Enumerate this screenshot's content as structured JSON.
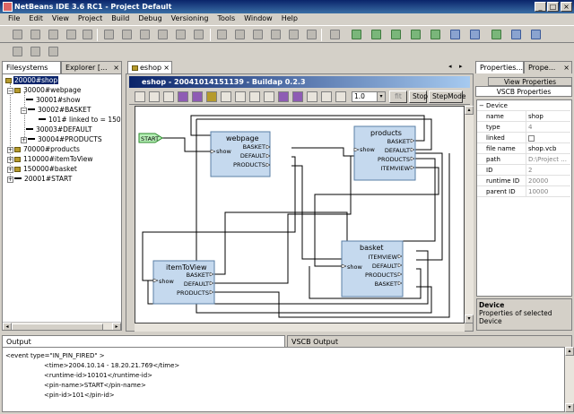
{
  "window": {
    "title": "NetBeans IDE 3.6 RC1 - Project Default",
    "controls": [
      "_",
      "□",
      "×"
    ]
  },
  "menu": [
    "File",
    "Edit",
    "View",
    "Project",
    "Build",
    "Debug",
    "Versioning",
    "Tools",
    "Window",
    "Help"
  ],
  "left_panel": {
    "tabs": [
      {
        "label": "Filesystems"
      },
      {
        "label": "Explorer [..."
      }
    ],
    "tree": [
      {
        "label": "20000#shop",
        "selected": true
      },
      {
        "label": "30000#webpage"
      },
      {
        "label": "30001#show"
      },
      {
        "label": "30002#BASKET"
      },
      {
        "label": "101# linked to = 15000"
      },
      {
        "label": "30003#DEFAULT"
      },
      {
        "label": "30004#PRODUCTS"
      },
      {
        "label": "70000#products"
      },
      {
        "label": "110000#itemToView"
      },
      {
        "label": "150000#basket"
      },
      {
        "label": "20001#START"
      }
    ]
  },
  "center_panel": {
    "tab_label": "eshop",
    "inner_title": "eshop - 20041014151139 - Buildap 0.2.3",
    "zoom_value": "1.0",
    "fit_label": "fit",
    "stop_label": "Stop",
    "stepmode_label": "StepMode",
    "diagram": {
      "start_label": "START",
      "nodes": [
        {
          "title": "webpage",
          "input": "show",
          "outputs": [
            "BASKET",
            "DEFAULT",
            "PRODUCTS"
          ]
        },
        {
          "title": "products",
          "input": "show",
          "outputs": [
            "BASKET",
            "DEFAULT",
            "PRODUCTS",
            "ITEMVIEW"
          ]
        },
        {
          "title": "itemToView",
          "input": "show",
          "outputs": [
            "BASKET",
            "DEFAULT",
            "PRODUCTS"
          ]
        },
        {
          "title": "basket",
          "input": "show",
          "outputs": [
            "ITEMVIEW",
            "DEFAULT",
            "PRODUCTS",
            "BASKET"
          ]
        }
      ]
    }
  },
  "right_panel": {
    "tabs": [
      {
        "label": "Properties..."
      },
      {
        "label": "Prope..."
      }
    ],
    "sub_tabs": [
      "View Properties",
      "VSCB Properties"
    ],
    "section": "Device",
    "properties": [
      {
        "key": "name",
        "value": "shop",
        "dim": false
      },
      {
        "key": "type",
        "value": "4",
        "dim": true
      },
      {
        "key": "linked",
        "value": "",
        "dim": true
      },
      {
        "key": "file name",
        "value": "shop.vcb",
        "dim": false
      },
      {
        "key": "path",
        "value": "D:\\Project ...",
        "dim": true
      },
      {
        "key": "ID",
        "value": "2",
        "dim": true
      },
      {
        "key": "runtime ID",
        "value": "20000",
        "dim": true
      },
      {
        "key": "parent ID",
        "value": "10000",
        "dim": true
      }
    ],
    "desc_title": "Device",
    "desc_text": "Properties of selected Device"
  },
  "bottom_panel": {
    "tabs": [
      {
        "label": "Output"
      },
      {
        "label": "VSCB Output"
      }
    ],
    "lines": [
      "<event type=\"IN_PIN_FIRED\" >",
      "<time>2004.10.14 - 18.20.21.769</time>",
      "<runtime-id>10101</runtime-id>",
      "<pin-name>START</pin-name>",
      "<pin-id>101</pin-id>"
    ]
  }
}
